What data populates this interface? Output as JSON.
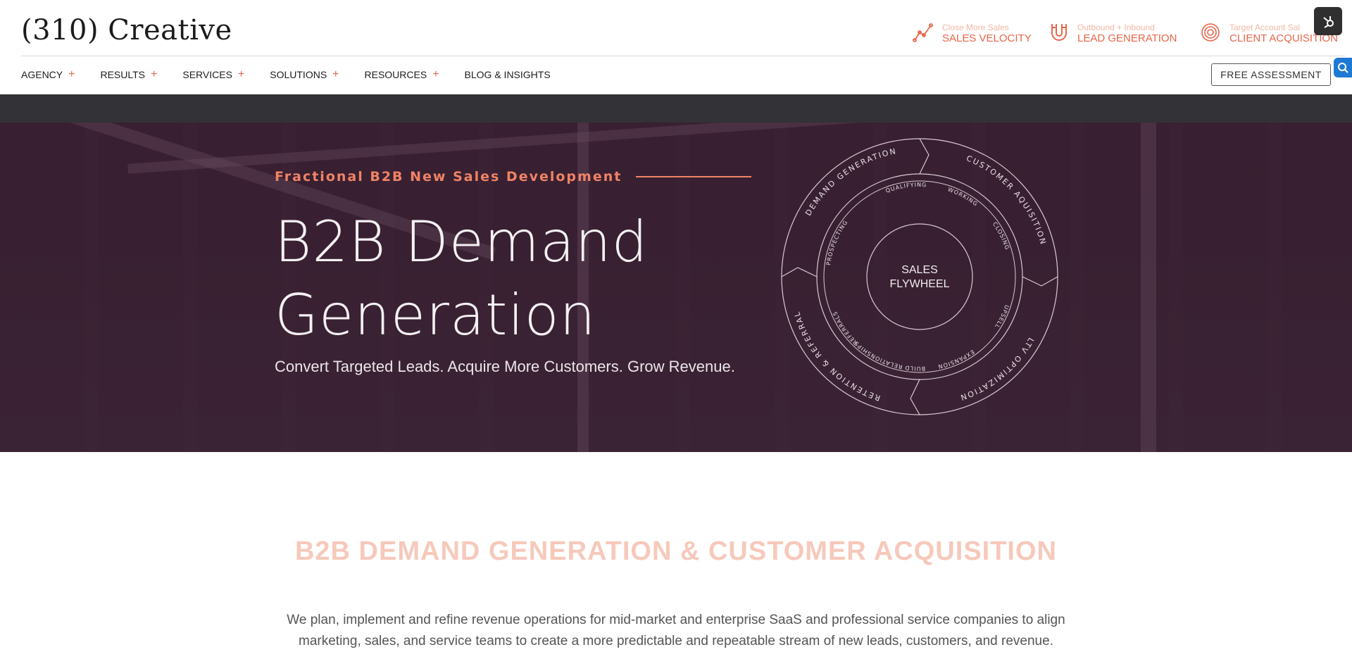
{
  "header": {
    "logo": "(310) Creative",
    "promos": [
      {
        "small": "Close More Sales",
        "big": "SALES VELOCITY",
        "icon": "trend-line-icon"
      },
      {
        "small": "Outbound + Inbound",
        "big": "LEAD GENERATION",
        "icon": "magnet-icon"
      },
      {
        "small": "Target Account Sal",
        "big": "CLIENT ACQUISITION",
        "icon": "target-icon"
      }
    ],
    "hubspot_icon": "hubspot-icon"
  },
  "nav": {
    "items": [
      {
        "label": "AGENCY",
        "expandable": true
      },
      {
        "label": "RESULTS",
        "expandable": true
      },
      {
        "label": "SERVICES",
        "expandable": true
      },
      {
        "label": "SOLUTIONS",
        "expandable": true
      },
      {
        "label": "RESOURCES",
        "expandable": true
      },
      {
        "label": "BLOG & INSIGHTS",
        "expandable": false
      }
    ],
    "plus_glyph": "+",
    "cta_label": "FREE ASSESSMENT"
  },
  "hero": {
    "kicker": "Fractional B2B New Sales Development",
    "title": "B2B Demand Generation",
    "subtitle": "Convert Targeted Leads. Acquire More Customers. Grow Revenue.",
    "flywheel": {
      "center": [
        "SALES",
        "FLYWHEEL"
      ],
      "outer": [
        "DEMAND GENERATION",
        "CUSTOMER AQUISITION",
        "LTV OPTIMIZATION",
        "RETENTION & REFERRAL"
      ],
      "inner": [
        "QUALIFYING",
        "WORKING",
        "CLOSING",
        "UPSELL",
        "EXPANSION",
        "BUILD",
        "RELATIONSHIPS",
        "REFERRALS",
        "PROSPECTING"
      ]
    }
  },
  "content": {
    "section_title": "B2B DEMAND GENERATION & CUSTOMER ACQUISITION",
    "body": "We plan, implement and refine revenue operations for mid-market and enterprise SaaS and professional service companies to align marketing, sales, and service teams to create a more predictable and repeatable stream of new leads, customers, and revenue."
  },
  "colors": {
    "accent": "#e7664a",
    "hero_bg": "#3b2537",
    "dark_bar": "#333236"
  }
}
